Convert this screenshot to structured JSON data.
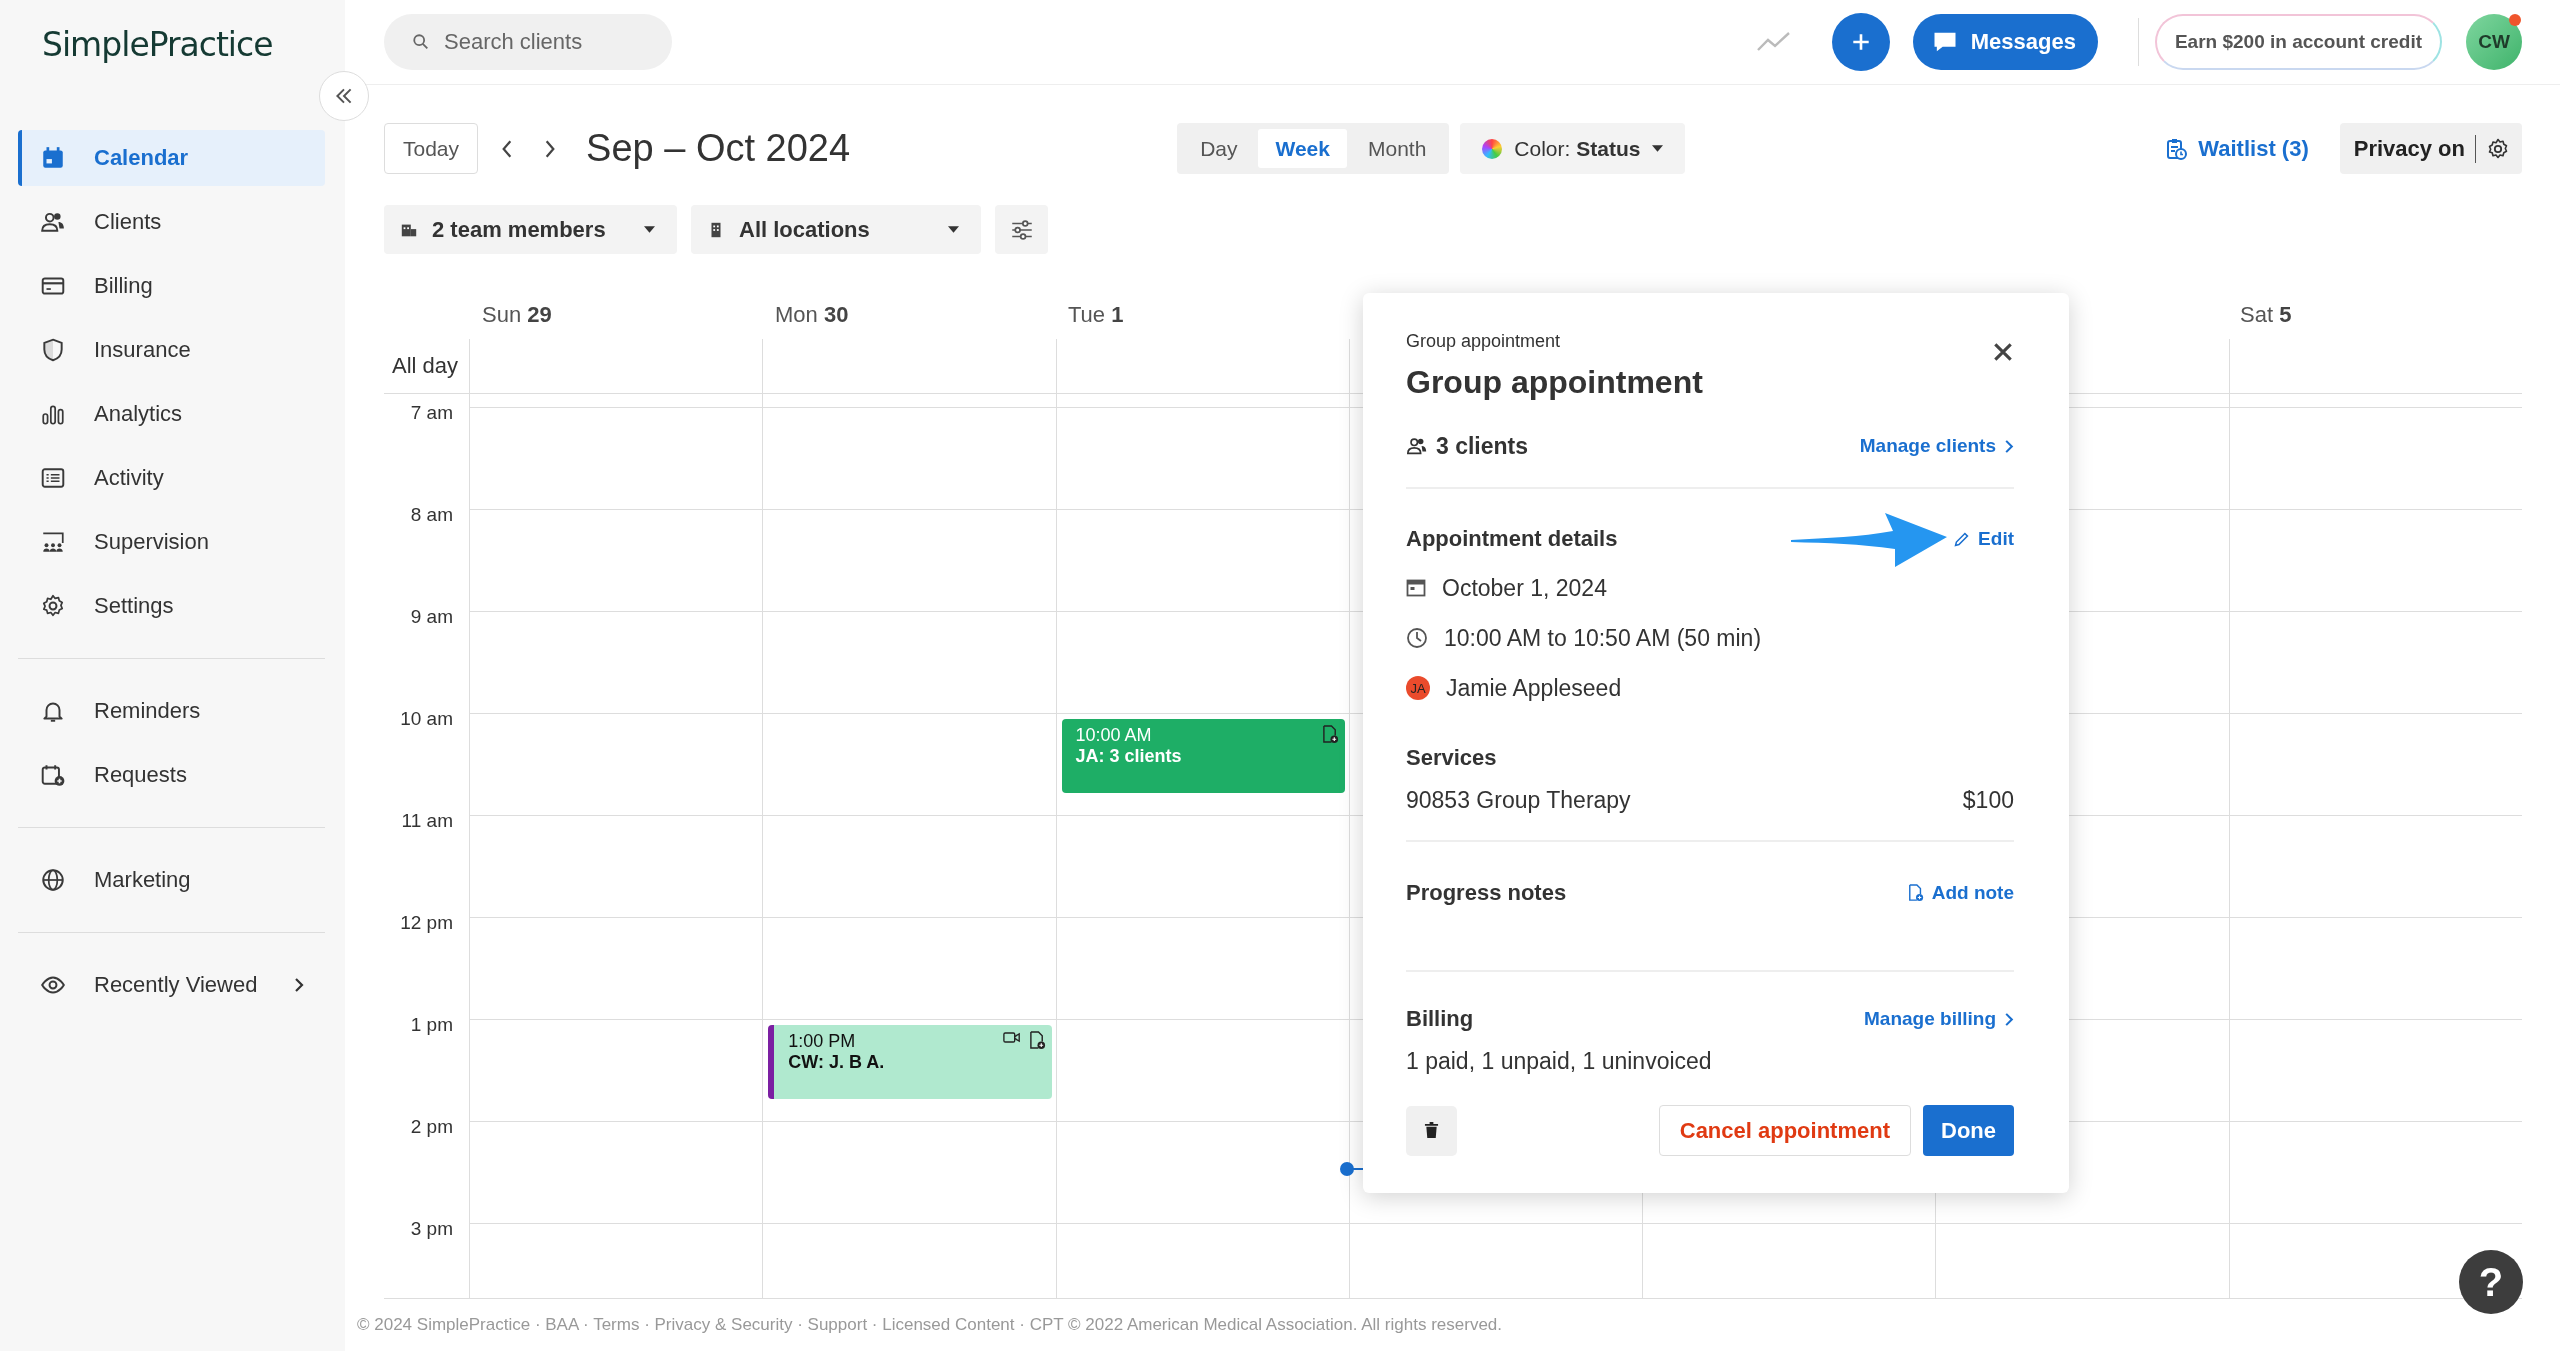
{
  "logo": "SimplePractice",
  "sidebar": {
    "sections": [
      {
        "items": [
          {
            "label": "Calendar",
            "selected": true,
            "submenu": false
          },
          {
            "label": "Clients",
            "selected": false,
            "submenu": false
          },
          {
            "label": "Billing",
            "selected": false,
            "submenu": false
          },
          {
            "label": "Insurance",
            "selected": false,
            "submenu": false
          },
          {
            "label": "Analytics",
            "selected": false,
            "submenu": false
          },
          {
            "label": "Activity",
            "selected": false,
            "submenu": false
          },
          {
            "label": "Supervision",
            "selected": false,
            "submenu": false
          },
          {
            "label": "Settings",
            "selected": false,
            "submenu": false
          }
        ]
      },
      {
        "items": [
          {
            "label": "Reminders",
            "selected": false,
            "submenu": false
          },
          {
            "label": "Requests",
            "selected": false,
            "submenu": false
          }
        ]
      },
      {
        "items": [
          {
            "label": "Marketing",
            "selected": false,
            "submenu": false
          }
        ]
      },
      {
        "items": [
          {
            "label": "Recently Viewed",
            "selected": false,
            "submenu": true
          }
        ]
      }
    ]
  },
  "top_bar": {
    "search": {
      "placeholder": "Search clients"
    },
    "messages": "Messages",
    "credit": "Earn $200 in account credit",
    "avatar": {
      "initials": "CW",
      "has_notification": true
    }
  },
  "toolbar": {
    "today": "Today",
    "range": "Sep – Oct 2024",
    "views": [
      {
        "label": "Day",
        "selected": false
      },
      {
        "label": "Week",
        "selected": true
      },
      {
        "label": "Month",
        "selected": false
      }
    ],
    "color_filter": "Color: **Status**",
    "waitlist": "Waitlist (3)",
    "privacy": "Privacy on"
  },
  "filters": {
    "team": "2 team members",
    "locations": "All locations"
  },
  "calendar": {
    "all_day_label": "All day",
    "hours": [
      "7 am",
      "8 am",
      "9 am",
      "10 am",
      "11 am",
      "12 pm",
      "1 pm",
      "2 pm",
      "3 pm"
    ],
    "now_indicator": true,
    "days": [
      {
        "label": "Sun",
        "date": "29"
      },
      {
        "label": "Mon",
        "date": "30",
        "events": [
          {
            "time": "1:00 PM",
            "title": "CW: J. B A.",
            "kind": "telehealth",
            "color": "#b0e9cf"
          }
        ]
      },
      {
        "label": "Tue",
        "date": "1",
        "events": [
          {
            "time": "10:00 AM",
            "title": "JA: 3 clients",
            "kind": "group",
            "color": "#1eae66"
          }
        ]
      },
      {
        "label": "Sat",
        "date": "5"
      }
    ]
  },
  "popup": {
    "eyebrow": "Group appointment",
    "title": "Group appointment",
    "clients": "3 clients",
    "manage_clients": "Manage clients",
    "details_heading": "Appointment details",
    "annotation": {
      "kind": "arrow"
    },
    "edit": "Edit",
    "date": "October 1, 2024",
    "time": "10:00 AM to 10:50 AM (50 min)",
    "clinician": {
      "initials": "JA",
      "name": "Jamie Appleseed"
    },
    "services_heading": "Services",
    "services": [
      {
        "name": "90853 Group Therapy",
        "price": "$100"
      }
    ],
    "notes_heading": "Progress notes",
    "add_note": "Add note",
    "billing_heading": "Billing",
    "manage_billing": "Manage billing",
    "billing_summary": "1 paid, 1 unpaid, 1 uninvoiced",
    "cancel": "Cancel appointment",
    "done": "Done"
  },
  "footer": "© 2024 SimplePractice · BAA · Terms · Privacy & Security · Support · Licensed Content · CPT © 2022 American Medical Association. All rights reserved.",
  "help": "?"
}
